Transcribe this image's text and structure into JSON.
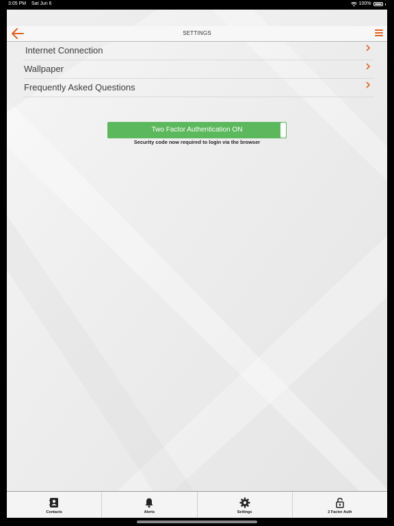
{
  "status_bar": {
    "time": "3:05 PM",
    "date": "Sat Jun 6",
    "battery": "100%",
    "wifi_icon": "wifi-icon",
    "battery_icon": "battery-icon"
  },
  "header": {
    "title": "SETTINGS",
    "back_icon": "arrow-left-icon",
    "menu_icon": "hamburger-menu-icon",
    "accent_color": "#e0611d"
  },
  "settings": {
    "items": [
      {
        "label": "Internet Connection"
      },
      {
        "label": "Wallpaper"
      },
      {
        "label": "Frequently Asked Questions"
      }
    ]
  },
  "two_factor": {
    "button_label": "Two Factor Authentication ON",
    "note": "Security code now required to login via the browser",
    "color": "#5cb85c"
  },
  "tabbar": {
    "tabs": [
      {
        "label": "Contacts",
        "icon": "contacts-icon"
      },
      {
        "label": "Alerts",
        "icon": "bell-icon"
      },
      {
        "label": "Settings",
        "icon": "gear-icon"
      },
      {
        "label": "2 Factor Auth",
        "icon": "lock-icon"
      }
    ]
  }
}
